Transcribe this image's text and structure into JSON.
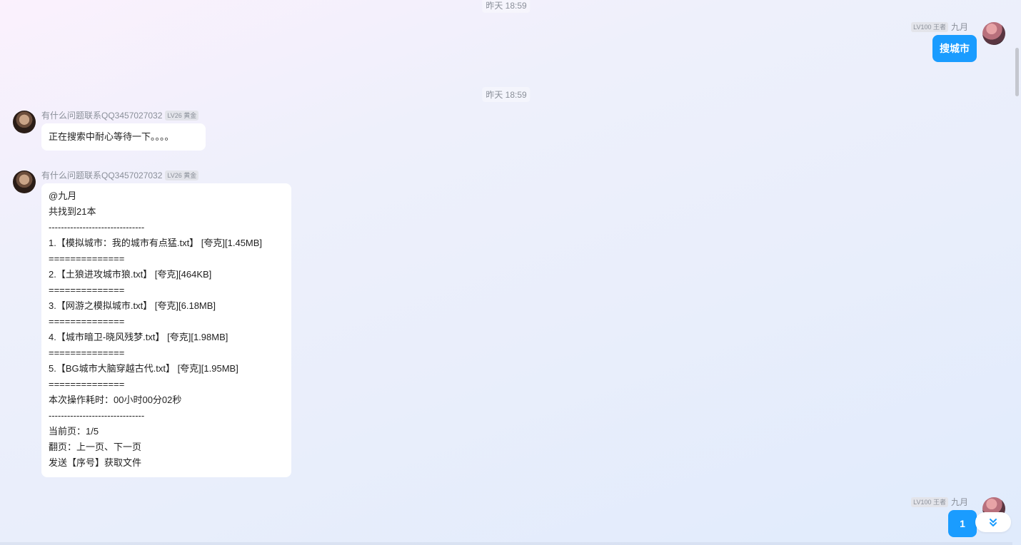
{
  "timestamps": [
    "昨天 18:59",
    "昨天 18:59"
  ],
  "me": {
    "name": "九月",
    "level_badge": "LV100 王者"
  },
  "bot": {
    "name": "有什么问题联系QQ3457027032",
    "level_badge": "LV26 黄金"
  },
  "messages": {
    "m1": "搜城市",
    "m2": "正在搜索中耐心等待一下。。。。",
    "m3": [
      "@九月",
      "共找到21本",
      "-------------------------------",
      "1.【模拟城市：我的城市有点猛.txt】 [夸克][1.45MB]",
      "==============",
      "2.【土狼进攻城市狼.txt】 [夸克][464KB]",
      "==============",
      "3.【网游之模拟城市.txt】 [夸克][6.18MB]",
      "==============",
      "4.【城市暗卫-晓风残梦.txt】 [夸克][1.98MB]",
      "==============",
      "5.【BG城市大脑穿越古代.txt】 [夸克][1.95MB]",
      "==============",
      "本次操作耗时：00小时00分02秒",
      "-------------------------------",
      "当前页：1/5",
      "翻页：上一页、下一页",
      "发送【序号】获取文件"
    ],
    "m4": "1"
  },
  "icons": {
    "scroll_down": "double-chevron-down-icon"
  },
  "colors": {
    "accent": "#1a9cff",
    "bubble_bg": "#ffffff"
  }
}
